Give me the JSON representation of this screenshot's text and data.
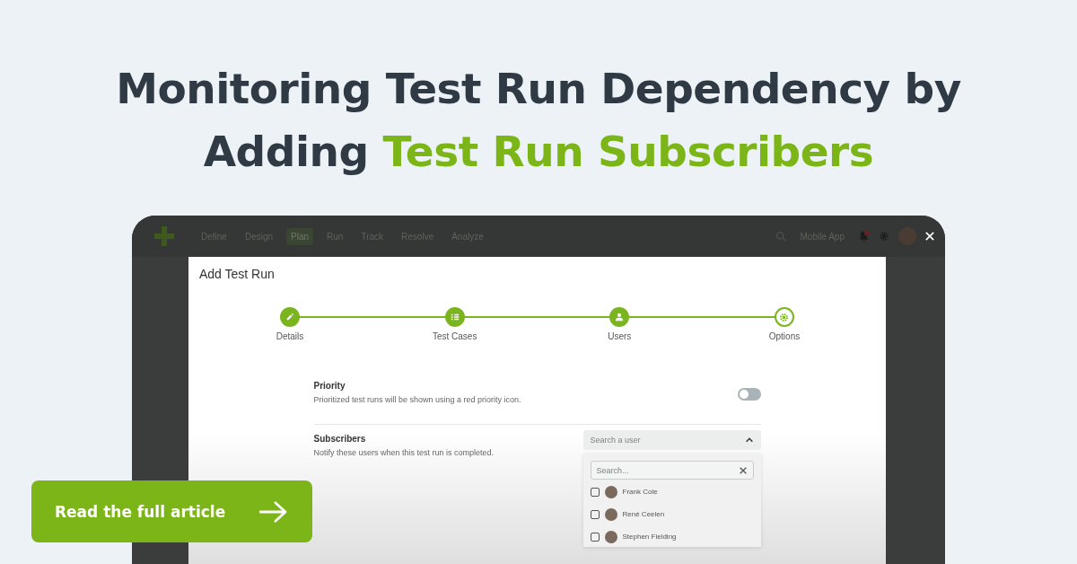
{
  "headline": "Monitoring Test Run Dependency by Adding **Test Run Subscribers**",
  "app": {
    "nav": [
      {
        "label": "Define",
        "selected": false
      },
      {
        "label": "Design",
        "selected": false
      },
      {
        "label": "Plan",
        "selected": true
      },
      {
        "label": "Run",
        "selected": false
      },
      {
        "label": "Track",
        "selected": false
      },
      {
        "label": "Resolve",
        "selected": false
      },
      {
        "label": "Analyze",
        "selected": false
      }
    ],
    "project": "Mobile App",
    "modal": {
      "title": "Add Test Run",
      "steps": [
        {
          "label": "Details",
          "kind": "edit",
          "current": false
        },
        {
          "label": "Test Cases",
          "kind": "list",
          "current": false
        },
        {
          "label": "Users",
          "kind": "user",
          "current": false
        },
        {
          "label": "Options",
          "kind": "gear",
          "current": true
        }
      ],
      "settings": [
        {
          "kind": "toggle",
          "title": "Priority",
          "description": "Prioritized test runs will be shown using a red priority icon.",
          "on": false
        },
        {
          "kind": "user-select",
          "title": "Subscribers",
          "description": "Notify these users when this test run is completed.",
          "placeholder": "Search a user",
          "expanded": true,
          "search_placeholder": "Search...",
          "users": [
            {
              "name": "Frank Cole",
              "checked": false
            },
            {
              "name": "René Ceelen",
              "checked": false
            },
            {
              "name": "Stephen Fielding",
              "checked": false
            }
          ]
        }
      ]
    }
  },
  "cta": {
    "label": "Read the full article"
  }
}
